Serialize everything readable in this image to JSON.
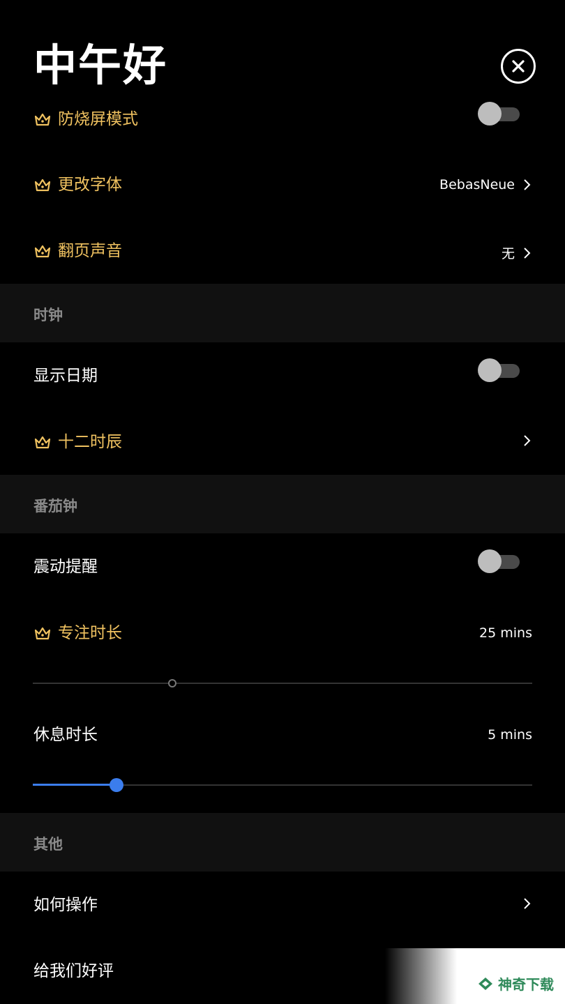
{
  "header": {
    "greeting": "中午好",
    "close_icon": "close-icon"
  },
  "rows": {
    "burn_in": {
      "label": "防烧屏模式",
      "premium": true,
      "toggle": false
    },
    "font": {
      "label": "更改字体",
      "premium": true,
      "value": "BebasNeue"
    },
    "page_sound": {
      "label": "翻页声音",
      "premium": true,
      "value": "无"
    }
  },
  "sections": {
    "clock": {
      "title": "时钟",
      "show_date": {
        "label": "显示日期",
        "toggle": false
      },
      "twelve_hours": {
        "label": "十二时辰",
        "premium": true
      }
    },
    "pomodoro": {
      "title": "番茄钟",
      "vibrate": {
        "label": "震动提醒",
        "toggle": false
      },
      "focus": {
        "label": "专注时长",
        "premium": true,
        "value": "25 mins",
        "slider_fraction": 0.28
      },
      "rest": {
        "label": "休息时长",
        "value": "5 mins",
        "slider_fraction": 0.167
      }
    },
    "other": {
      "title": "其他",
      "how_to": {
        "label": "如何操作"
      },
      "rate_us": {
        "label": "给我们好评"
      }
    }
  },
  "watermark": {
    "text": "神奇下载"
  },
  "colors": {
    "premium": "#f0c260",
    "accent": "#3b7ded",
    "section_bg": "#111111"
  }
}
